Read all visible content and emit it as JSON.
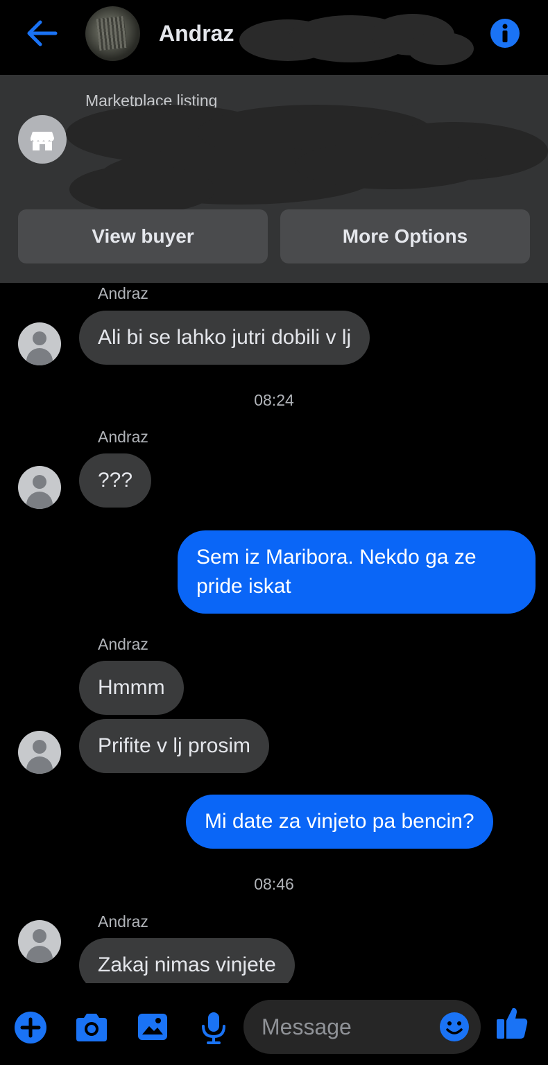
{
  "header": {
    "contact_name": "Andraz"
  },
  "marketplace": {
    "label": "Marketplace listing",
    "view_buyer": "View buyer",
    "more_options": "More Options"
  },
  "messages": [
    {
      "sender": "Andraz",
      "text": "Ali bi se lahko jutri dobili v lj"
    },
    {
      "timestamp": "08:24"
    },
    {
      "sender": "Andraz",
      "text": "???"
    },
    {
      "outgoing_line1": "Sem iz Maribora. Nekdo ga ze",
      "outgoing_line2": "pride iskat"
    },
    {
      "sender": "Andraz",
      "text1": "Hmmm",
      "text2": "Prifite v lj prosim"
    },
    {
      "outgoing": "Mi date za vinjeto pa bencin?"
    },
    {
      "timestamp": "08:46"
    },
    {
      "sender": "Andraz",
      "text": "Zakaj nimas vinjete"
    }
  ],
  "composer": {
    "placeholder": "Message"
  },
  "colors": {
    "accent": "#0a66f7",
    "incoming_bubble": "#3a3b3c",
    "panel": "#333435"
  }
}
